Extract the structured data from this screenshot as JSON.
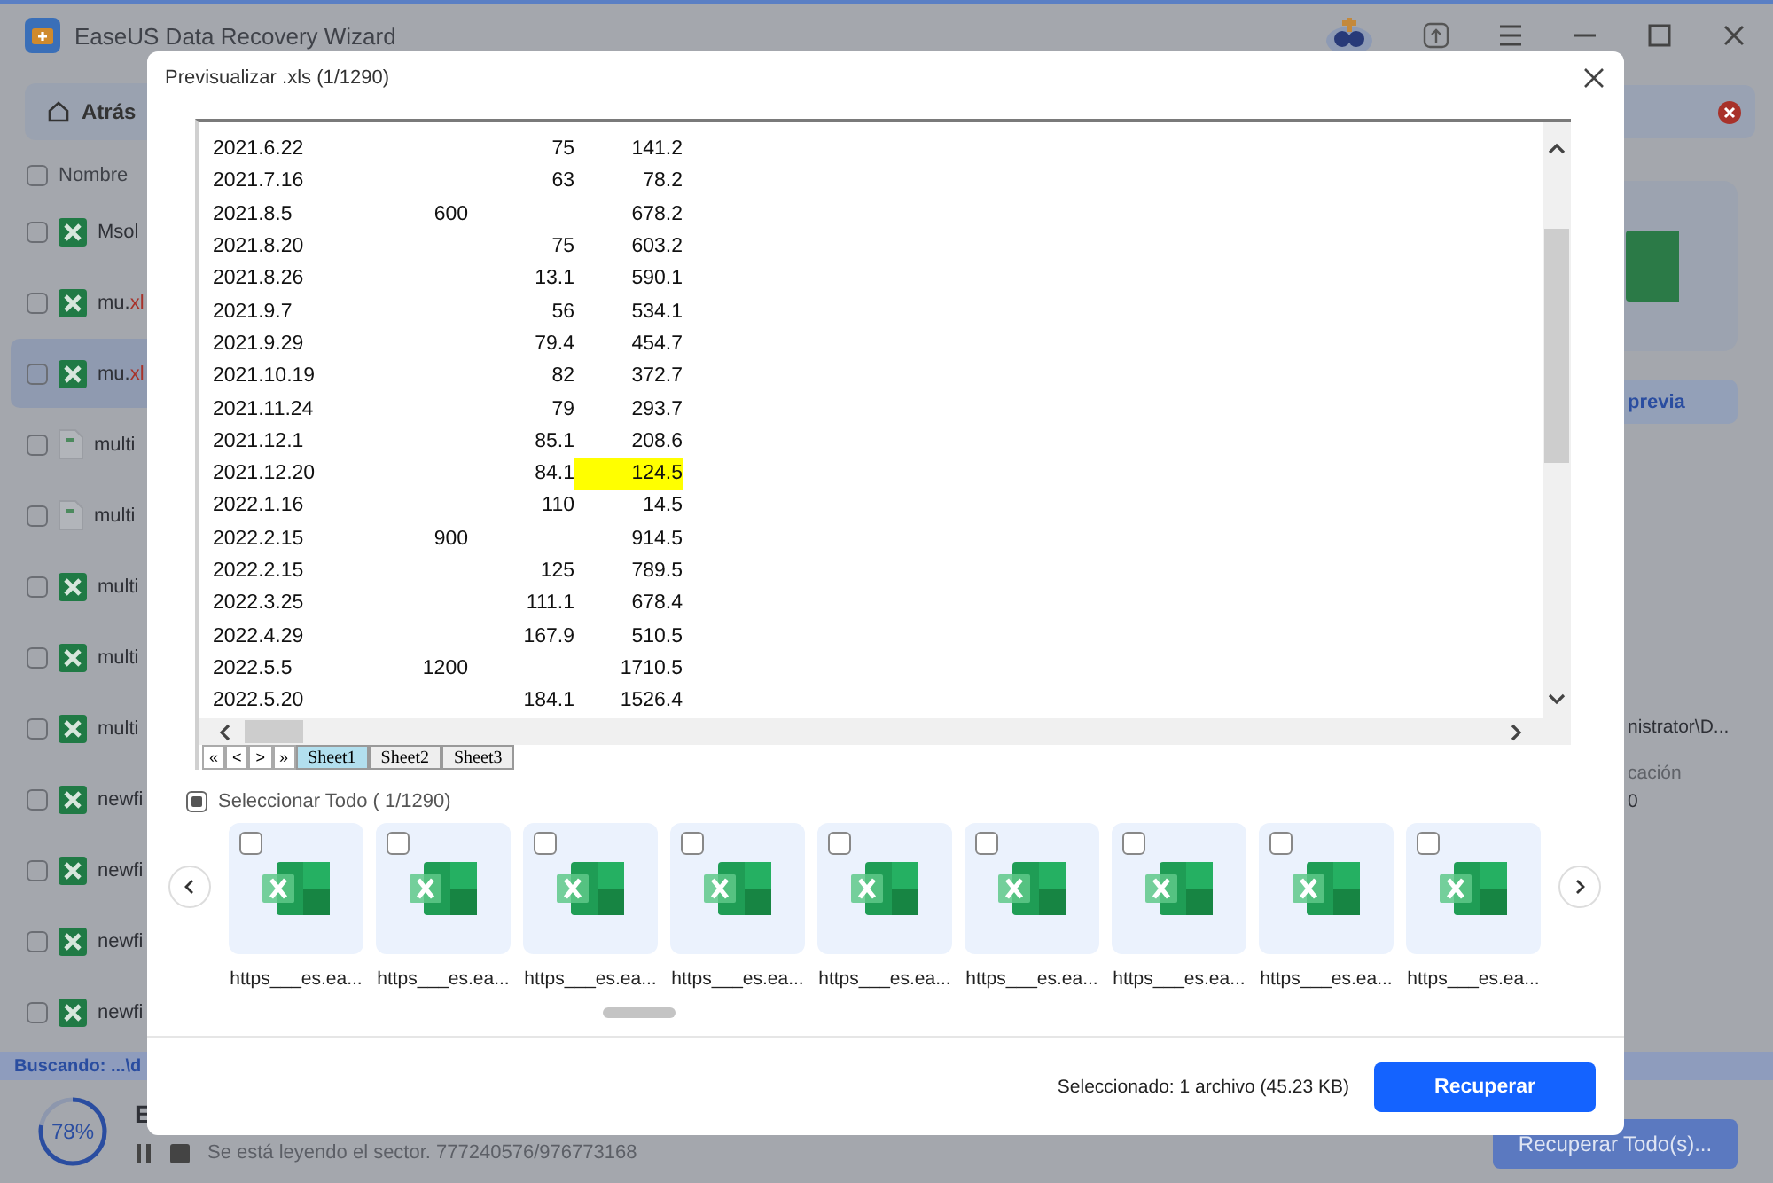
{
  "app": {
    "title": "EaseUS Data Recovery Wizard",
    "back_button": "Atrás",
    "header_label": "Nombre",
    "header_checked": false,
    "files": [
      {
        "name": "Msol",
        "kind": "xls",
        "selected": false,
        "checked": false
      },
      {
        "name": "mu.",
        "ext": "xl",
        "kind": "xls",
        "selected": false,
        "checked": false
      },
      {
        "name": "mu.",
        "ext": "xl",
        "kind": "xls",
        "selected": true,
        "checked": false
      },
      {
        "name": "multi",
        "kind": "doc",
        "selected": false,
        "checked": false
      },
      {
        "name": "multi",
        "kind": "doc",
        "selected": false,
        "checked": false
      },
      {
        "name": "multi",
        "kind": "xls",
        "selected": false,
        "checked": false
      },
      {
        "name": "multi",
        "kind": "xls",
        "selected": false,
        "checked": false
      },
      {
        "name": "multi",
        "kind": "xls",
        "selected": false,
        "checked": false
      },
      {
        "name": "newfi",
        "kind": "xls",
        "selected": false,
        "checked": false
      },
      {
        "name": "newfi",
        "kind": "xls",
        "selected": false,
        "checked": false
      },
      {
        "name": "newfi",
        "kind": "xls",
        "selected": false,
        "checked": false
      },
      {
        "name": "newfi",
        "kind": "xls",
        "selected": false,
        "checked": false
      }
    ],
    "side_panel": {
      "preview_button": "previa",
      "path": "nistrator\\D...",
      "label": "cación",
      "value": "0"
    },
    "status": "Buscando: ...\\d",
    "progress": {
      "percent": "78%",
      "level": 0.78,
      "title": "E",
      "message": "Se está leyendo el sector. 777240576/976773168",
      "recover_all": "Recuperar Todo(s)..."
    }
  },
  "preview": {
    "title": "Previsualizar .xls (1/1290)",
    "sheet": {
      "rows": [
        {
          "cells": [
            "2021.6.22",
            null,
            "75",
            "141.2"
          ],
          "highlighted": false
        },
        {
          "cells": [
            "2021.7.16",
            null,
            "63",
            "78.2"
          ],
          "highlighted": false
        },
        {
          "cells": [
            "2021.8.5",
            "600",
            null,
            "678.2"
          ],
          "highlighted": false
        },
        {
          "cells": [
            "2021.8.20",
            null,
            "75",
            "603.2"
          ],
          "highlighted": false
        },
        {
          "cells": [
            "2021.8.26",
            null,
            "13.1",
            "590.1"
          ],
          "highlighted": false
        },
        {
          "cells": [
            "2021.9.7",
            null,
            "56",
            "534.1"
          ],
          "highlighted": false
        },
        {
          "cells": [
            "2021.9.29",
            null,
            "79.4",
            "454.7"
          ],
          "highlighted": false
        },
        {
          "cells": [
            "2021.10.19",
            null,
            "82",
            "372.7"
          ],
          "highlighted": false
        },
        {
          "cells": [
            "2021.11.24",
            null,
            "79",
            "293.7"
          ],
          "highlighted": false
        },
        {
          "cells": [
            "2021.12.1",
            null,
            "85.1",
            "208.6"
          ],
          "highlighted": false
        },
        {
          "cells": [
            "2021.12.20",
            null,
            "84.1",
            "124.5"
          ],
          "highlighted": true
        },
        {
          "cells": [
            "2022.1.16",
            null,
            "110",
            "14.5"
          ],
          "highlighted": false
        },
        {
          "cells": [
            "2022.2.15",
            "900",
            null,
            "914.5"
          ],
          "highlighted": false
        },
        {
          "cells": [
            "2022.2.15",
            null,
            "125",
            "789.5"
          ],
          "highlighted": false
        },
        {
          "cells": [
            "2022.3.25",
            null,
            "111.1",
            "678.4"
          ],
          "highlighted": false
        },
        {
          "cells": [
            "2022.4.29",
            null,
            "167.9",
            "510.5"
          ],
          "highlighted": false
        },
        {
          "cells": [
            "2022.5.5",
            "1200",
            null,
            "1710.5"
          ],
          "highlighted": false
        },
        {
          "cells": [
            "2022.5.20",
            null,
            "184.1",
            "1526.4"
          ],
          "highlighted": false
        }
      ],
      "nav_buttons": [
        "«",
        "<",
        ">",
        "»"
      ],
      "tabs": [
        {
          "label": "Sheet1",
          "selected": true
        },
        {
          "label": "Sheet2",
          "selected": false
        },
        {
          "label": "Sheet3",
          "selected": false
        }
      ]
    },
    "select_all": {
      "label": "Seleccionar Todo ( 1/1290)",
      "indeterminate": true
    },
    "thumbnails": [
      {
        "caption": "https___es.ea...",
        "checked": false
      },
      {
        "caption": "https___es.ea...",
        "checked": false
      },
      {
        "caption": "https___es.ea...",
        "checked": false
      },
      {
        "caption": "https___es.ea...",
        "checked": false
      },
      {
        "caption": "https___es.ea...",
        "checked": false
      },
      {
        "caption": "https___es.ea...",
        "checked": false
      },
      {
        "caption": "https___es.ea...",
        "checked": false
      },
      {
        "caption": "https___es.ea...",
        "checked": false
      },
      {
        "caption": "https___es.ea...",
        "checked": false
      }
    ],
    "footer": {
      "summary": "Seleccionado: 1 archivo (45.23 KB)",
      "button": "Recuperar"
    }
  }
}
